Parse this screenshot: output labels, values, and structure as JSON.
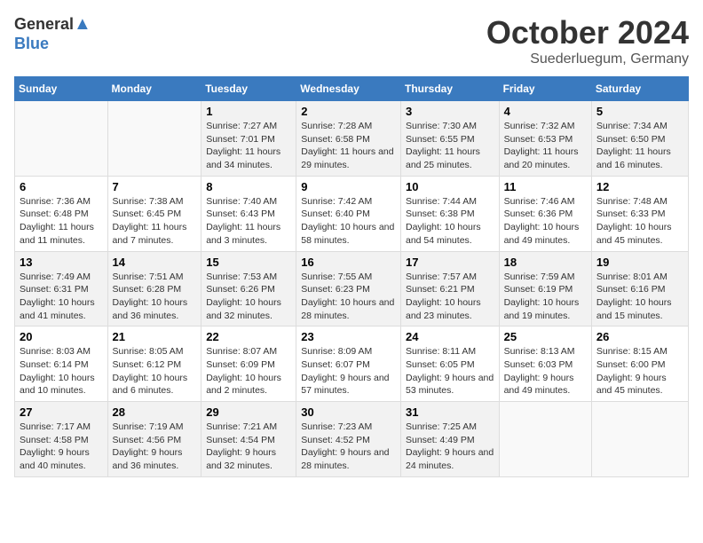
{
  "logo": {
    "general": "General",
    "blue": "Blue"
  },
  "title": "October 2024",
  "location": "Suederluegum, Germany",
  "days_of_week": [
    "Sunday",
    "Monday",
    "Tuesday",
    "Wednesday",
    "Thursday",
    "Friday",
    "Saturday"
  ],
  "weeks": [
    [
      {
        "day": "",
        "sunrise": "",
        "sunset": "",
        "daylight": ""
      },
      {
        "day": "",
        "sunrise": "",
        "sunset": "",
        "daylight": ""
      },
      {
        "day": "1",
        "sunrise": "Sunrise: 7:27 AM",
        "sunset": "Sunset: 7:01 PM",
        "daylight": "Daylight: 11 hours and 34 minutes."
      },
      {
        "day": "2",
        "sunrise": "Sunrise: 7:28 AM",
        "sunset": "Sunset: 6:58 PM",
        "daylight": "Daylight: 11 hours and 29 minutes."
      },
      {
        "day": "3",
        "sunrise": "Sunrise: 7:30 AM",
        "sunset": "Sunset: 6:55 PM",
        "daylight": "Daylight: 11 hours and 25 minutes."
      },
      {
        "day": "4",
        "sunrise": "Sunrise: 7:32 AM",
        "sunset": "Sunset: 6:53 PM",
        "daylight": "Daylight: 11 hours and 20 minutes."
      },
      {
        "day": "5",
        "sunrise": "Sunrise: 7:34 AM",
        "sunset": "Sunset: 6:50 PM",
        "daylight": "Daylight: 11 hours and 16 minutes."
      }
    ],
    [
      {
        "day": "6",
        "sunrise": "Sunrise: 7:36 AM",
        "sunset": "Sunset: 6:48 PM",
        "daylight": "Daylight: 11 hours and 11 minutes."
      },
      {
        "day": "7",
        "sunrise": "Sunrise: 7:38 AM",
        "sunset": "Sunset: 6:45 PM",
        "daylight": "Daylight: 11 hours and 7 minutes."
      },
      {
        "day": "8",
        "sunrise": "Sunrise: 7:40 AM",
        "sunset": "Sunset: 6:43 PM",
        "daylight": "Daylight: 11 hours and 3 minutes."
      },
      {
        "day": "9",
        "sunrise": "Sunrise: 7:42 AM",
        "sunset": "Sunset: 6:40 PM",
        "daylight": "Daylight: 10 hours and 58 minutes."
      },
      {
        "day": "10",
        "sunrise": "Sunrise: 7:44 AM",
        "sunset": "Sunset: 6:38 PM",
        "daylight": "Daylight: 10 hours and 54 minutes."
      },
      {
        "day": "11",
        "sunrise": "Sunrise: 7:46 AM",
        "sunset": "Sunset: 6:36 PM",
        "daylight": "Daylight: 10 hours and 49 minutes."
      },
      {
        "day": "12",
        "sunrise": "Sunrise: 7:48 AM",
        "sunset": "Sunset: 6:33 PM",
        "daylight": "Daylight: 10 hours and 45 minutes."
      }
    ],
    [
      {
        "day": "13",
        "sunrise": "Sunrise: 7:49 AM",
        "sunset": "Sunset: 6:31 PM",
        "daylight": "Daylight: 10 hours and 41 minutes."
      },
      {
        "day": "14",
        "sunrise": "Sunrise: 7:51 AM",
        "sunset": "Sunset: 6:28 PM",
        "daylight": "Daylight: 10 hours and 36 minutes."
      },
      {
        "day": "15",
        "sunrise": "Sunrise: 7:53 AM",
        "sunset": "Sunset: 6:26 PM",
        "daylight": "Daylight: 10 hours and 32 minutes."
      },
      {
        "day": "16",
        "sunrise": "Sunrise: 7:55 AM",
        "sunset": "Sunset: 6:23 PM",
        "daylight": "Daylight: 10 hours and 28 minutes."
      },
      {
        "day": "17",
        "sunrise": "Sunrise: 7:57 AM",
        "sunset": "Sunset: 6:21 PM",
        "daylight": "Daylight: 10 hours and 23 minutes."
      },
      {
        "day": "18",
        "sunrise": "Sunrise: 7:59 AM",
        "sunset": "Sunset: 6:19 PM",
        "daylight": "Daylight: 10 hours and 19 minutes."
      },
      {
        "day": "19",
        "sunrise": "Sunrise: 8:01 AM",
        "sunset": "Sunset: 6:16 PM",
        "daylight": "Daylight: 10 hours and 15 minutes."
      }
    ],
    [
      {
        "day": "20",
        "sunrise": "Sunrise: 8:03 AM",
        "sunset": "Sunset: 6:14 PM",
        "daylight": "Daylight: 10 hours and 10 minutes."
      },
      {
        "day": "21",
        "sunrise": "Sunrise: 8:05 AM",
        "sunset": "Sunset: 6:12 PM",
        "daylight": "Daylight: 10 hours and 6 minutes."
      },
      {
        "day": "22",
        "sunrise": "Sunrise: 8:07 AM",
        "sunset": "Sunset: 6:09 PM",
        "daylight": "Daylight: 10 hours and 2 minutes."
      },
      {
        "day": "23",
        "sunrise": "Sunrise: 8:09 AM",
        "sunset": "Sunset: 6:07 PM",
        "daylight": "Daylight: 9 hours and 57 minutes."
      },
      {
        "day": "24",
        "sunrise": "Sunrise: 8:11 AM",
        "sunset": "Sunset: 6:05 PM",
        "daylight": "Daylight: 9 hours and 53 minutes."
      },
      {
        "day": "25",
        "sunrise": "Sunrise: 8:13 AM",
        "sunset": "Sunset: 6:03 PM",
        "daylight": "Daylight: 9 hours and 49 minutes."
      },
      {
        "day": "26",
        "sunrise": "Sunrise: 8:15 AM",
        "sunset": "Sunset: 6:00 PM",
        "daylight": "Daylight: 9 hours and 45 minutes."
      }
    ],
    [
      {
        "day": "27",
        "sunrise": "Sunrise: 7:17 AM",
        "sunset": "Sunset: 4:58 PM",
        "daylight": "Daylight: 9 hours and 40 minutes."
      },
      {
        "day": "28",
        "sunrise": "Sunrise: 7:19 AM",
        "sunset": "Sunset: 4:56 PM",
        "daylight": "Daylight: 9 hours and 36 minutes."
      },
      {
        "day": "29",
        "sunrise": "Sunrise: 7:21 AM",
        "sunset": "Sunset: 4:54 PM",
        "daylight": "Daylight: 9 hours and 32 minutes."
      },
      {
        "day": "30",
        "sunrise": "Sunrise: 7:23 AM",
        "sunset": "Sunset: 4:52 PM",
        "daylight": "Daylight: 9 hours and 28 minutes."
      },
      {
        "day": "31",
        "sunrise": "Sunrise: 7:25 AM",
        "sunset": "Sunset: 4:49 PM",
        "daylight": "Daylight: 9 hours and 24 minutes."
      },
      {
        "day": "",
        "sunrise": "",
        "sunset": "",
        "daylight": ""
      },
      {
        "day": "",
        "sunrise": "",
        "sunset": "",
        "daylight": ""
      }
    ]
  ]
}
